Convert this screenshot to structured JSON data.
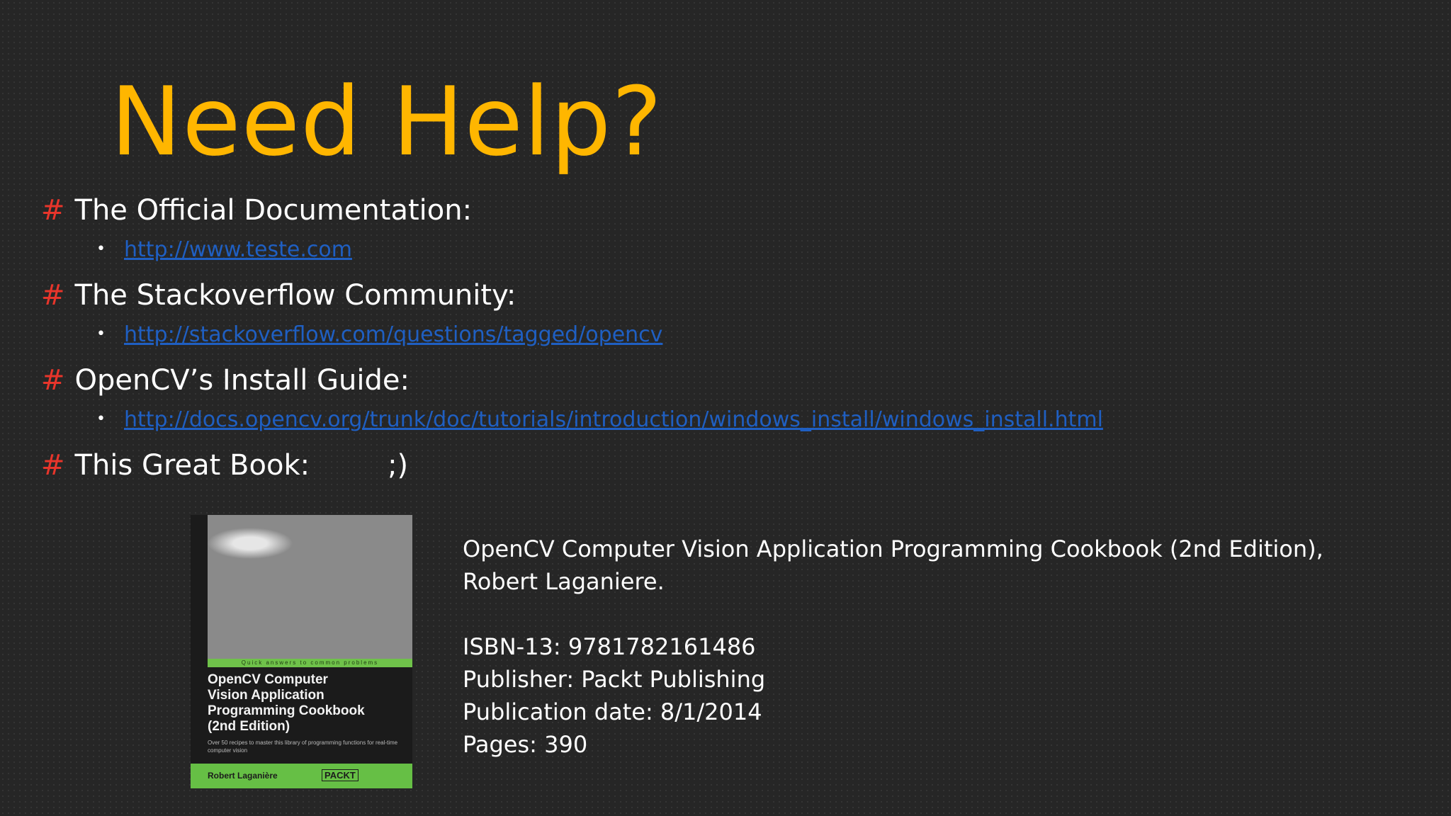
{
  "slide": {
    "title": "Need Help?",
    "sections": [
      {
        "marker": "#",
        "heading": "The Official Documentation:",
        "link": "http://www.teste.com"
      },
      {
        "marker": "#",
        "heading": "The Stackoverflow Community:",
        "link": "http://stackoverflow.com/questions/tagged/opencv"
      },
      {
        "marker": "#",
        "heading": "OpenCV’s Install Guide:",
        "link": "http://docs.opencv.org/trunk/doc/tutorials/introduction/windows_install/windows_install.html"
      },
      {
        "marker": "#",
        "heading": "This Great Book:",
        "suffix": ";)"
      }
    ],
    "bullet": "•"
  },
  "book": {
    "full_title_line1": "OpenCV Computer Vision Application Programming Cookbook (2nd Edition),",
    "author_line": "Robert Laganiere.",
    "isbn": "ISBN-13: 9781782161486",
    "publisher": "Publisher: Packt Publishing",
    "publication_date": "Publication date: 8/1/2014",
    "pages": "Pages: 390",
    "cover": {
      "strip_text": "Quick answers to common problems",
      "title": "OpenCV Computer\nVision Application\nProgramming Cookbook\n(2nd Edition)",
      "subtitle": "Over 50 recipes to master this library of programming functions for real-time computer vision",
      "author": "Robert Laganière",
      "publisher_logo": "PACKT",
      "accent_color": "#6fc24a"
    }
  },
  "colors": {
    "title": "#ffb600",
    "marker": "#e8352b",
    "link": "#1f5fc2",
    "background": "#262626"
  }
}
